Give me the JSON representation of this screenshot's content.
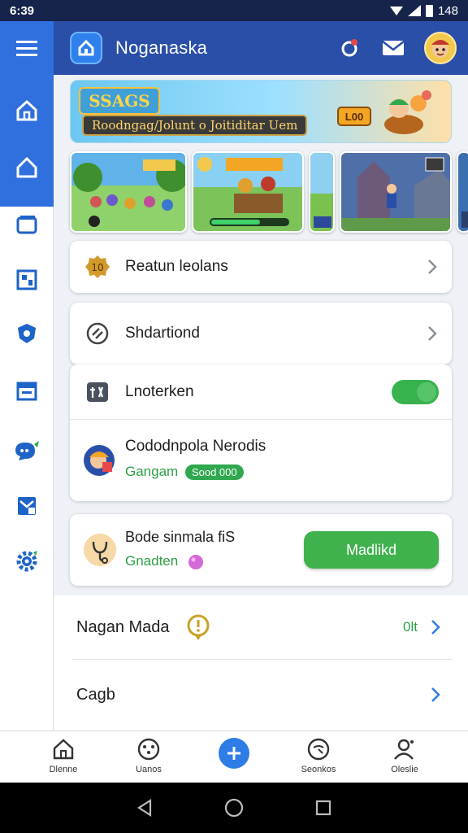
{
  "status_bar": {
    "time": "6:39",
    "battery": "148"
  },
  "app_bar": {
    "title": "Noganaska"
  },
  "sidebar": {
    "items": [
      {
        "icon": "menu-icon"
      },
      {
        "icon": "home-icon"
      },
      {
        "icon": "home-outline-icon"
      },
      {
        "icon": "cards-icon"
      },
      {
        "icon": "dashboard-icon"
      },
      {
        "icon": "shield-icon"
      },
      {
        "icon": "calendar-icon"
      },
      {
        "icon": "chat-icon"
      },
      {
        "icon": "mail-icon"
      },
      {
        "icon": "settings-icon"
      }
    ]
  },
  "banner": {
    "badge_text": "SSAGS",
    "caption": "Roodngag/Jolunt o Joitiditar Uem",
    "coin_label": "L00"
  },
  "rows": {
    "reason_label": "Reatun leolans",
    "shortened_label": "Shdartiond",
    "interactive_label": "Lnoterken",
    "coordinates_title": "Cododnpola Nerodis",
    "coordinates_sub": "Gangam",
    "coordinates_tag": "Sood 000",
    "code_title": "Bode sinmala fiS",
    "code_sub": "Gnadten",
    "code_button": "Madlikd",
    "nagan_label": "Nagan Mada",
    "nagan_value": "0lt",
    "cagb_label": "Cagb"
  },
  "bottom_nav": [
    {
      "label": "Dlenne"
    },
    {
      "label": "Uanos"
    },
    {
      "label": ""
    },
    {
      "label": "Seonkos"
    },
    {
      "label": "Oleslie"
    }
  ],
  "colors": {
    "primary": "#2f6fde",
    "appbar": "#2a4fa8",
    "success": "#3fb24e"
  }
}
